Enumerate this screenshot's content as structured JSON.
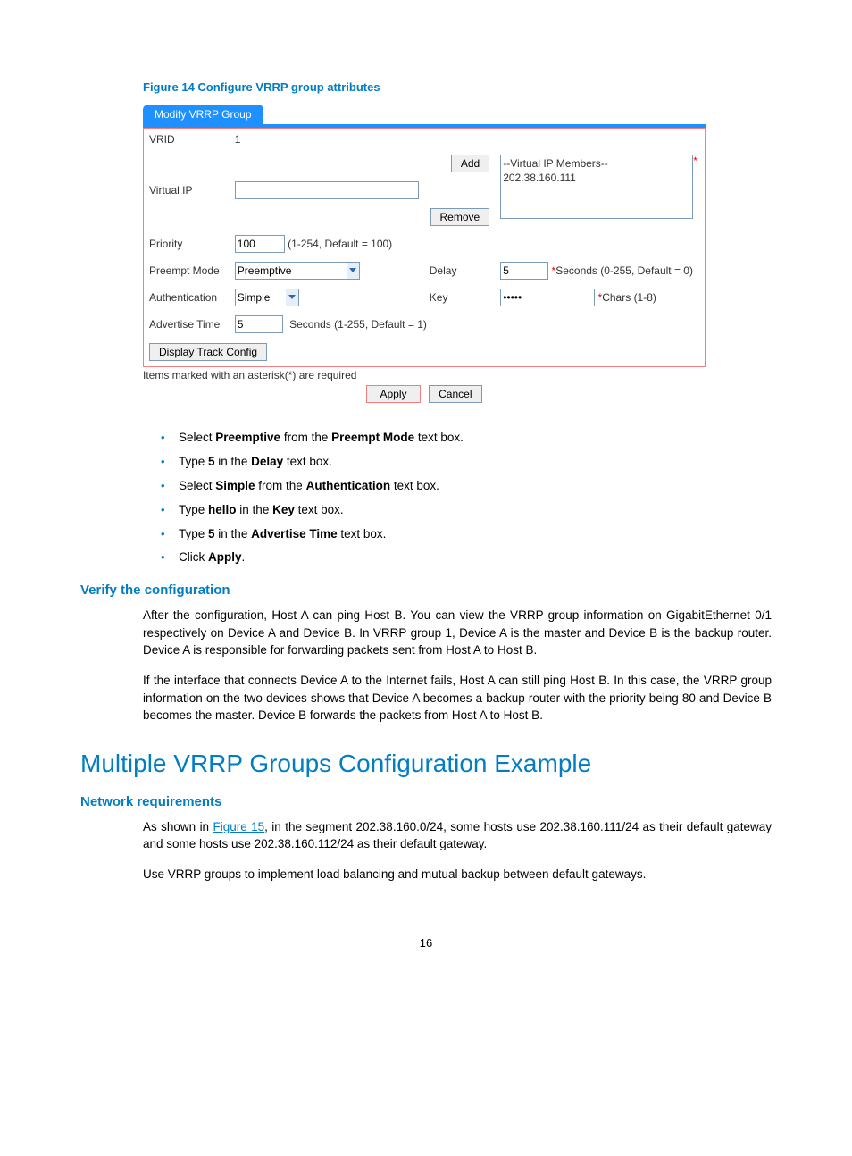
{
  "figure": {
    "caption": "Figure 14 Configure VRRP group attributes"
  },
  "form": {
    "tab": "Modify VRRP Group",
    "vrid_label": "VRID",
    "vrid_value": "1",
    "virtual_ip_label": "Virtual IP",
    "virtual_ip_value": "",
    "add_btn": "Add",
    "remove_btn": "Remove",
    "members_header": "--Virtual IP Members--",
    "members_item": "202.38.160.111",
    "priority_label": "Priority",
    "priority_value": "100",
    "priority_hint": "(1-254, Default = 100)",
    "preempt_label": "Preempt Mode",
    "preempt_value": "Preemptive",
    "delay_label": "Delay",
    "delay_value": "5",
    "delay_hint": "Seconds (0-255, Default = 0)",
    "auth_label": "Authentication",
    "auth_value": "Simple",
    "key_label": "Key",
    "key_value": "•••••",
    "key_hint": "Chars (1-8)",
    "adv_label": "Advertise Time",
    "adv_value": "5",
    "adv_hint": "Seconds (1-255, Default = 1)",
    "track_btn": "Display Track Config",
    "required_note": "Items marked with an asterisk(*) are required",
    "apply_btn": "Apply",
    "cancel_btn": "Cancel"
  },
  "bullets": {
    "b1a": "Select ",
    "b1b": "Preemptive",
    "b1c": " from the ",
    "b1d": "Preempt Mode",
    "b1e": " text box.",
    "b2a": "Type ",
    "b2b": "5",
    "b2c": " in the ",
    "b2d": "Delay",
    "b2e": " text box.",
    "b3a": "Select ",
    "b3b": "Simple",
    "b3c": " from the ",
    "b3d": "Authentication",
    "b3e": " text box.",
    "b4a": "Type ",
    "b4b": "hello",
    "b4c": " in the ",
    "b4d": "Key",
    "b4e": " text box.",
    "b5a": "Type ",
    "b5b": "5",
    "b5c": " in the ",
    "b5d": "Advertise Time",
    "b5e": " text box.",
    "b6a": "Click ",
    "b6b": "Apply",
    "b6c": "."
  },
  "verify": {
    "heading": "Verify the configuration",
    "p1": "After the configuration, Host A can ping Host B. You can view the VRRP group information on GigabitEthernet 0/1 respectively on Device A and Device B. In VRRP group 1, Device A is the master and Device B is the backup router. Device A is responsible for forwarding packets sent from Host A to Host B.",
    "p2": "If the interface that connects Device A to the Internet fails, Host A can still ping Host B. In this case, the VRRP group information on the two devices shows that Device A becomes a backup router with the priority being 80 and Device B becomes the master. Device B forwards the packets from Host A to Host B."
  },
  "multi": {
    "title": "Multiple VRRP Groups Configuration Example",
    "req_heading": "Network requirements",
    "p1a": "As shown in ",
    "p1link": "Figure 15",
    "p1b": ", in the segment 202.38.160.0/24, some hosts use 202.38.160.111/24 as their default gateway and some hosts use 202.38.160.112/24 as their default gateway.",
    "p2": "Use VRRP groups to implement load balancing and mutual backup between default gateways."
  },
  "pageno": "16"
}
